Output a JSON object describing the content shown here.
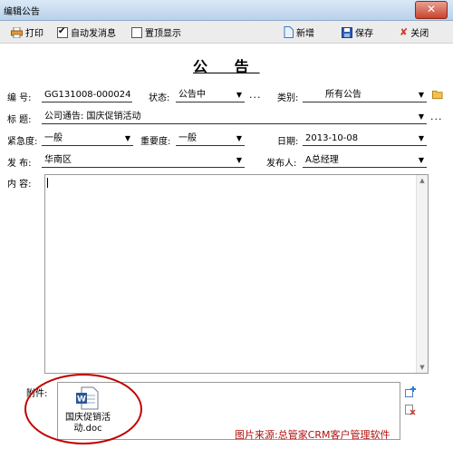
{
  "window": {
    "title": "编辑公告",
    "close_glyph": "✕"
  },
  "toolbar": {
    "print_label": "打印",
    "auto_send_label": "自动发消息",
    "auto_send_checked": true,
    "pin_top_label": "置顶显示",
    "pin_top_checked": false,
    "new_label": "新增",
    "save_label": "保存",
    "close_label": "关闭"
  },
  "form": {
    "heading": "公 告",
    "number_label": "编  号:",
    "number_value": "GG131008-000024",
    "status_label": "状态:",
    "status_value": "公告中",
    "category_label": "类别:",
    "category_value": "所有公告",
    "subject_label": "标  题:",
    "subject_value": "公司通告: 国庆促销活动",
    "urgency_label": "紧急度:",
    "urgency_value": "一般",
    "importance_label": "重要度:",
    "importance_value": "一般",
    "date_label": "日期:",
    "date_value": "2013-10-08",
    "publish_label": "发  布:",
    "publish_value": "华南区",
    "publisher_label": "发布人:",
    "publisher_value": "A总经理",
    "content_label": "内  容:",
    "content_value": "",
    "dots": "...",
    "attachment_label": "附件:",
    "attachment_name": "国庆促销活动.doc"
  },
  "watermark": "图片来源:总管家CRM客户管理软件",
  "colors": {
    "accent_red": "#c00000",
    "titlebar": "#c9dcf0"
  }
}
